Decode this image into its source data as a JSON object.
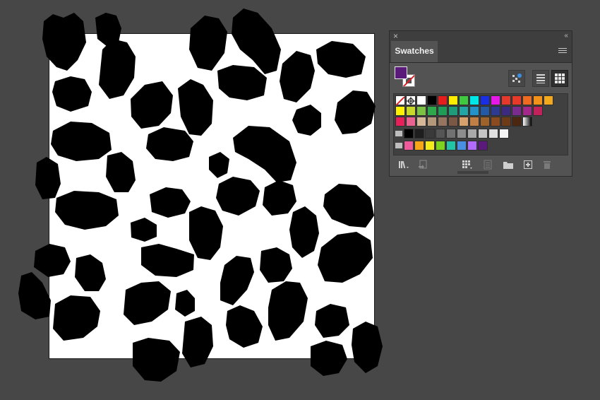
{
  "app": {
    "background": "#474747"
  },
  "panel": {
    "tab_label": "Swatches",
    "close_glyph": "×",
    "collapse_glyph": "‹‹",
    "fill_color": "#5a1a7a",
    "icons": [
      "swatch-libraries-menu-icon",
      "place-swatch-icon",
      "swatch-options-icon",
      "new-color-group-icon",
      "new-swatch-icon",
      "delete-swatch-icon",
      "show-kinds-icon"
    ]
  },
  "swatches": {
    "row1": [
      "none",
      "registration",
      "#ffffff",
      "#000000",
      "#e51d1d",
      "#ffec00",
      "#3ec93e",
      "#00e6e6",
      "#1a2ee6",
      "#e61ae6",
      "#e6392b",
      "#e63a2a",
      "#ee6b1f",
      "#f39219",
      "#f4a81c"
    ],
    "row2": [
      "#fff200",
      "#c7d82b",
      "#7cc242",
      "#2ea84a",
      "#1e9d57",
      "#1f9b79",
      "#22a5a5",
      "#2392c9",
      "#2459a8",
      "#2e3a8f",
      "#3b2a7f",
      "#7a2c8e",
      "#a3288a",
      "#c2225c"
    ],
    "row3": [
      "#e8205a",
      "#e96390",
      "#d6b899",
      "#b5977a",
      "#957561",
      "#7a5845",
      "#d8a06a",
      "#c07f45",
      "#a0622b",
      "#8b4b1e",
      "#6f3a16",
      "#4b2610",
      "gradient"
    ],
    "group1": [
      "#000000",
      "#1e1e1e",
      "#3a3a3a",
      "#555555",
      "#717171",
      "#8d8d8d",
      "#a9a9a9",
      "#c5c5c5",
      "#e0e0e0",
      "#f5f5f5"
    ],
    "group2": [
      "#ef5a9a",
      "#f7a61a",
      "#f4ec18",
      "#7ed321",
      "#22c3a6",
      "#4a90e2",
      "#b36bff",
      "#5a1a7a"
    ]
  }
}
